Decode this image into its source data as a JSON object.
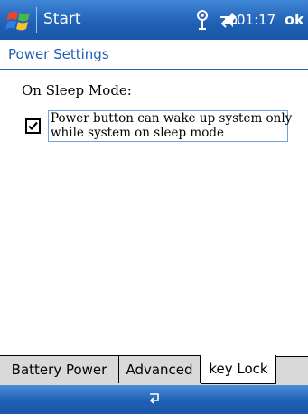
{
  "titlebar": {
    "app_title": "Start",
    "clock": "01:17",
    "ok_label": "ok",
    "icons": {
      "start": "windows-flag-icon",
      "connectivity": "connectivity-icon",
      "sync": "sync-arrows-icon",
      "volume": "speaker-icon"
    },
    "colors": {
      "bar": "#1f5fb4",
      "text": "#ffffff"
    }
  },
  "page": {
    "title": "Power Settings",
    "title_color": "#1f5fb4"
  },
  "sleep_section": {
    "label": "On Sleep Mode:",
    "checkbox_checked": true,
    "checkbox_label_line1": "Power button can wake up system only",
    "checkbox_label_line2": "while system on sleep mode"
  },
  "tabs": [
    {
      "label": "Battery Power",
      "selected": false
    },
    {
      "label": "Advanced",
      "selected": false
    },
    {
      "label": "key Lock",
      "selected": true
    }
  ],
  "bottombar": {
    "sip_icon": "keyboard-sip-icon"
  }
}
